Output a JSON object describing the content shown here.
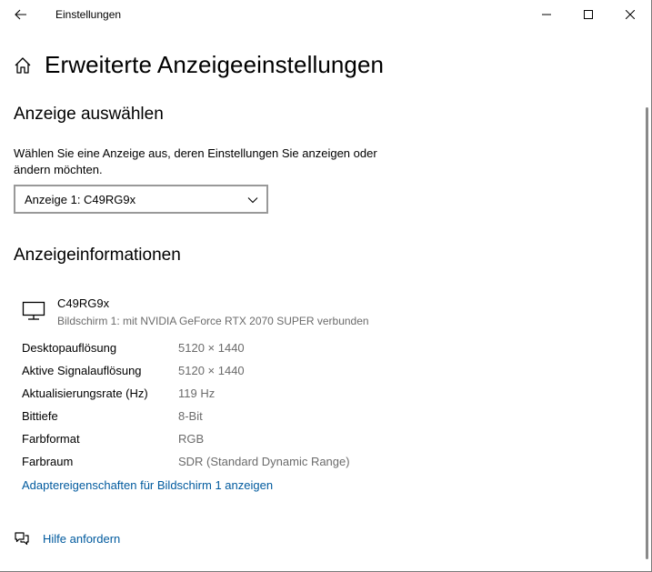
{
  "titlebar": {
    "title": "Einstellungen",
    "icons": {
      "back": "arrow-left-icon",
      "minimize": "minimize-icon",
      "maximize": "maximize-icon",
      "close": "close-icon"
    }
  },
  "page": {
    "title": "Erweiterte Anzeigeeinstellungen",
    "icon": "home-icon"
  },
  "select_display": {
    "section_title": "Anzeige auswählen",
    "description": "Wählen Sie eine Anzeige aus, deren Einstellungen Sie anzeigen oder ändern möchten.",
    "selected": "Anzeige 1: C49RG9x"
  },
  "display_info": {
    "section_title": "Anzeigeinformationen",
    "monitor_name": "C49RG9x",
    "monitor_subtitle": "Bildschirm 1: mit NVIDIA GeForce RTX 2070 SUPER verbunden",
    "rows": [
      {
        "label": "Desktopauflösung",
        "value": "5120 × 1440"
      },
      {
        "label": "Aktive Signalauflösung",
        "value": "5120 × 1440"
      },
      {
        "label": "Aktualisierungsrate (Hz)",
        "value": "119 Hz"
      },
      {
        "label": "Bittiefe",
        "value": "8-Bit"
      },
      {
        "label": "Farbformat",
        "value": "RGB"
      },
      {
        "label": "Farbraum",
        "value": "SDR (Standard Dynamic Range)"
      }
    ],
    "adapter_link": "Adaptereigenschaften für Bildschirm 1 anzeigen"
  },
  "help": {
    "label": "Hilfe anfordern"
  },
  "colors": {
    "link": "#005a9e",
    "secondary_text": "#6b6b6b",
    "border": "#999999"
  }
}
